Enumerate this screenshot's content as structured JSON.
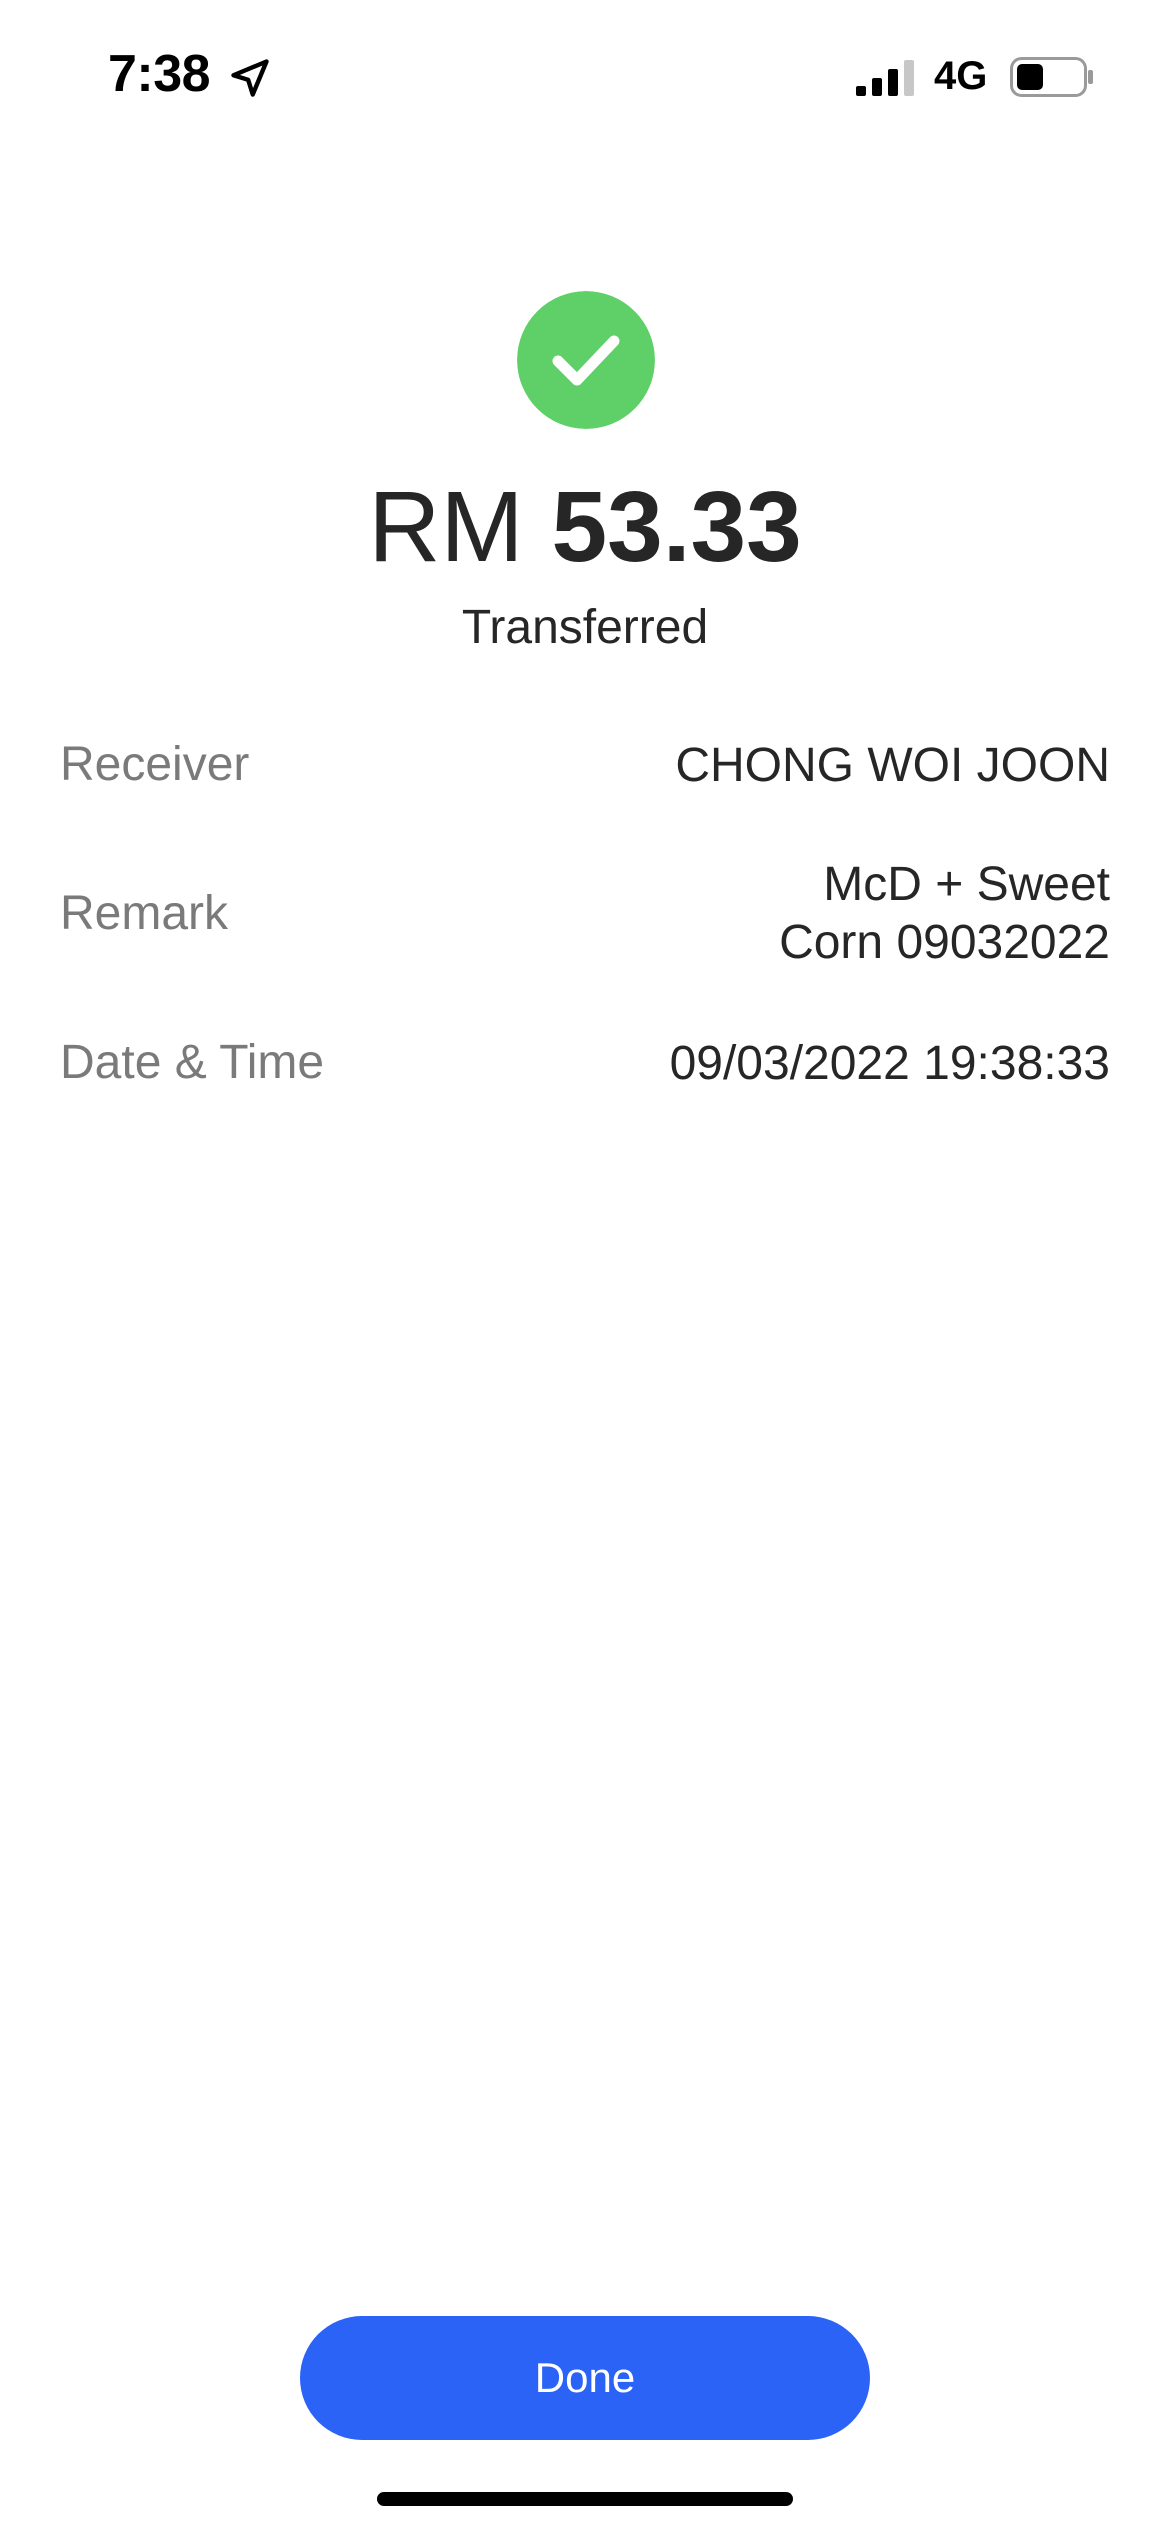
{
  "status_bar": {
    "time": "7:38",
    "network": "4G",
    "location_icon": "location-arrow-icon",
    "signal_icon": "cellular-signal-icon",
    "signal_bars_active": 3,
    "signal_bars_total": 4,
    "battery_icon": "battery-icon",
    "battery_level": 0.35
  },
  "result": {
    "icon": "checkmark-circle-icon",
    "icon_color": "#5FD068",
    "currency": "RM",
    "amount": "53.33",
    "status": "Transferred"
  },
  "details": {
    "receiver_label": "Receiver",
    "receiver_value": "CHONG WOI JOON",
    "remark_label": "Remark",
    "remark_line1": "McD + Sweet",
    "remark_line2": "Corn 09032022",
    "datetime_label": "Date & Time",
    "datetime_value": "09/03/2022 19:38:33"
  },
  "actions": {
    "done_label": "Done",
    "done_color": "#2B63F6"
  }
}
